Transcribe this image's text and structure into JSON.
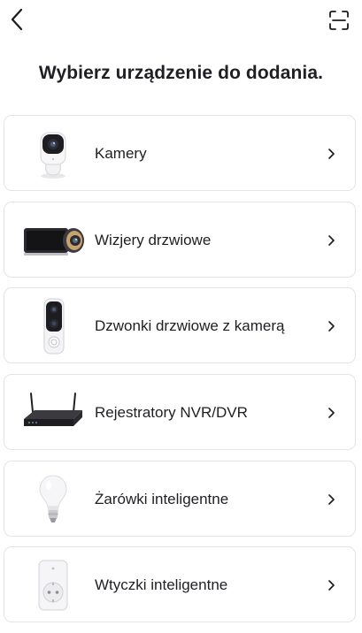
{
  "header": {
    "back_icon": "chevron-left-icon",
    "scan_icon": "scan-frame-icon"
  },
  "title": "Wybierz urządzenie do dodania.",
  "devices": [
    {
      "label": "Kamery",
      "icon": "indoor-camera-icon"
    },
    {
      "label": "Wizjery drzwiowe",
      "icon": "door-viewer-icon"
    },
    {
      "label": "Dzwonki drzwiowe z kamerą",
      "icon": "video-doorbell-icon"
    },
    {
      "label": "Rejestratory NVR/DVR",
      "icon": "nvr-recorder-icon"
    },
    {
      "label": "Żarówki inteligentne",
      "icon": "smart-bulb-icon"
    },
    {
      "label": "Wtyczki inteligentne",
      "icon": "smart-plug-icon"
    }
  ]
}
